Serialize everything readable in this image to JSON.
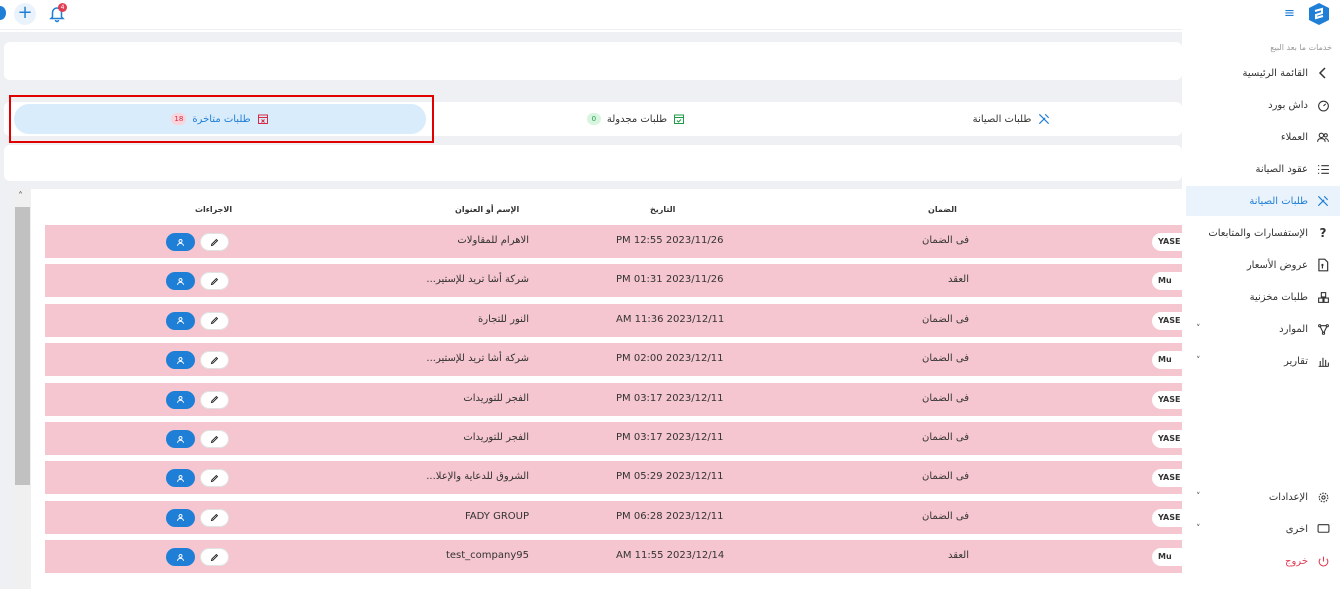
{
  "topbar": {
    "notifications_count": "4"
  },
  "tabs": [
    {
      "label": "طلبات الصيانة",
      "badge": ""
    },
    {
      "label": "طلبات مجدولة",
      "badge": "0"
    },
    {
      "label": "طلبات متاخرة",
      "badge": "18"
    }
  ],
  "table": {
    "headers": {
      "actions": "الاجراءات",
      "name": "الإسم أو العنوان",
      "date": "التاريخ",
      "warranty": "الضمان"
    },
    "rows": [
      {
        "name": "الاهرام للمقاولات",
        "date": "PM 12:55 2023/11/26",
        "warranty": "فى الضمان",
        "user": "YASE"
      },
      {
        "name": "...شركة أشا تريد للإستير",
        "date": "PM 01:31 2023/11/26",
        "warranty": "العقد",
        "user": "Mu"
      },
      {
        "name": "النور للتجارة",
        "date": "AM 11:36 2023/12/11",
        "warranty": "فى الضمان",
        "user": "YASE"
      },
      {
        "name": "...شركة أشا تريد للإستير",
        "date": "PM 02:00 2023/12/11",
        "warranty": "فى الضمان",
        "user": "Mu"
      },
      {
        "name": "الفجر للتوريدات",
        "date": "PM 03:17 2023/12/11",
        "warranty": "فى الضمان",
        "user": "YASE"
      },
      {
        "name": "الفجر للتوريدات",
        "date": "PM 03:17 2023/12/11",
        "warranty": "فى الضمان",
        "user": "YASE"
      },
      {
        "name": "...الشروق للدعاية والإعلا",
        "date": "PM 05:29 2023/12/11",
        "warranty": "فى الضمان",
        "user": "YASE"
      },
      {
        "name": "FADY GROUP",
        "date": "PM 06:28 2023/12/11",
        "warranty": "فى الضمان",
        "user": "YASE"
      },
      {
        "name": "test_company95",
        "date": "AM 11:55 2023/12/14",
        "warranty": "العقد",
        "user": "Mu"
      }
    ]
  },
  "sidebar": {
    "section_title": "خدمات ما بعد البيع",
    "items": [
      {
        "label": "القائمة الرئيسية"
      },
      {
        "label": "داش بورد"
      },
      {
        "label": "العملاء"
      },
      {
        "label": "عقود الصيانة"
      },
      {
        "label": "طلبات الصيانة"
      },
      {
        "label": "الإستفسارات والمتابعات"
      },
      {
        "label": "عروض الأسعار"
      },
      {
        "label": "طلبات مخزنية"
      },
      {
        "label": "الموارد"
      },
      {
        "label": "تقارير"
      }
    ],
    "bottom": [
      {
        "label": "الإعدادات"
      },
      {
        "label": "اخرى"
      },
      {
        "label": "خروج"
      }
    ]
  },
  "colors": {
    "accent": "#1f7fd6",
    "row_highlight": "#f5c6cf",
    "annotation": "#e00000"
  }
}
